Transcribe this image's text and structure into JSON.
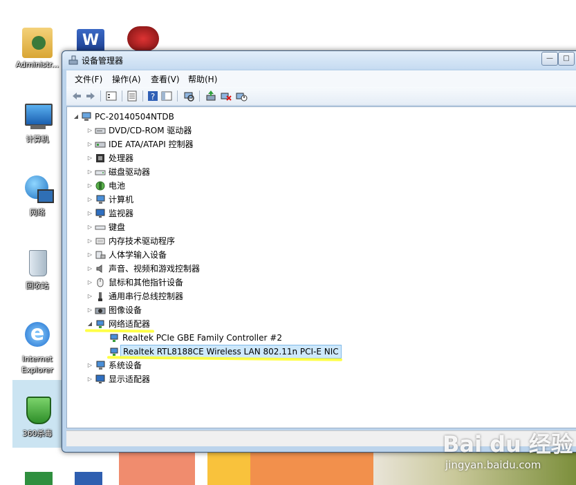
{
  "desktop": {
    "icons": [
      {
        "label": "Administr..."
      },
      {
        "label": "计算机"
      },
      {
        "label": "网络"
      },
      {
        "label": "回收站"
      },
      {
        "label": "Internet Explorer"
      },
      {
        "label": "360杀毒"
      }
    ]
  },
  "window": {
    "title": "设备管理器",
    "menu": [
      "文件(F)",
      "操作(A)",
      "查看(V)",
      "帮助(H)"
    ]
  },
  "tree": {
    "root": "PC-20140504NTDB",
    "categories": [
      "DVD/CD-ROM 驱动器",
      "IDE ATA/ATAPI 控制器",
      "处理器",
      "磁盘驱动器",
      "电池",
      "计算机",
      "监视器",
      "键盘",
      "内存技术驱动程序",
      "人体学输入设备",
      "声音、视频和游戏控制器",
      "鼠标和其他指针设备",
      "通用串行总线控制器",
      "图像设备",
      "网络适配器",
      "系统设备",
      "显示适配器"
    ],
    "network_children": [
      "Realtek PCIe GBE Family Controller #2",
      "Realtek RTL8188CE Wireless LAN 802.11n PCI-E NIC"
    ]
  },
  "watermark": {
    "logo": "Bai du 经验",
    "url": "jingyan.baidu.com"
  },
  "colors": {
    "highlight": "#ffff33",
    "selection": "#cde8fb",
    "titlebar": "#c6dbf1"
  }
}
